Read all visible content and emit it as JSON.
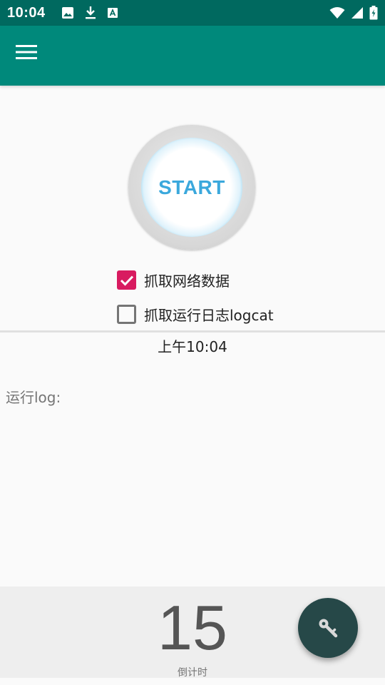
{
  "status_bar": {
    "time": "10:04",
    "icons_left": [
      "image-icon",
      "download-icon",
      "font-icon"
    ],
    "icons_right": [
      "wifi-icon",
      "signal-icon",
      "battery-charging-icon"
    ]
  },
  "app_bar": {
    "menu_icon": "hamburger-menu-icon",
    "color": "#00897b"
  },
  "start_button": {
    "label": "START"
  },
  "checkboxes": [
    {
      "label": "抓取网络数据",
      "checked": true
    },
    {
      "label": "抓取运行日志logcat",
      "checked": false
    }
  ],
  "clock": "上午10:04",
  "log": {
    "label": "运行log:"
  },
  "countdown": {
    "value": "15",
    "caption": "倒计时"
  },
  "fab": {
    "icon": "key-icon"
  },
  "colors": {
    "status_bar": "#00695f",
    "accent": "#d81b60",
    "fab": "#264848"
  }
}
